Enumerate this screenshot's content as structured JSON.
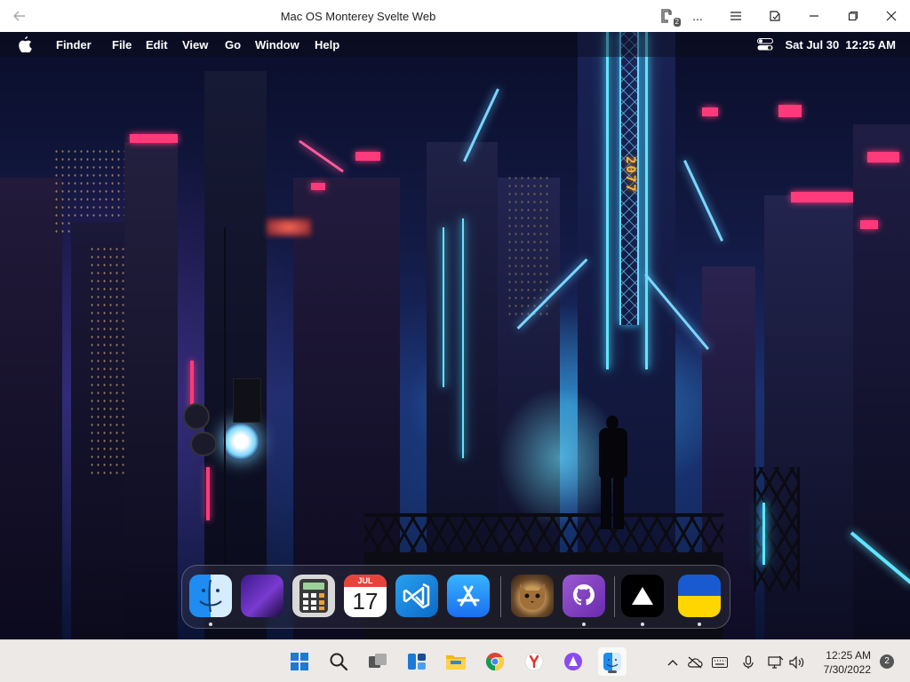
{
  "window": {
    "title": "Mac OS Monterey Svelte Web",
    "extension_badge": "2",
    "more_label": "..."
  },
  "menubar": {
    "app_name": "Finder",
    "items": [
      "File",
      "Edit",
      "View",
      "Go",
      "Window",
      "Help"
    ],
    "datetime": "Sat Jul 30  12:25 AM"
  },
  "wallpaper": {
    "tower_text": "2077"
  },
  "dock": {
    "apps": [
      {
        "name": "Finder",
        "icon": "finder-icon",
        "running": true
      },
      {
        "name": "Wallpapers",
        "icon": "wallpaper-icon",
        "running": false
      },
      {
        "name": "Calculator",
        "icon": "calculator-icon",
        "running": false
      },
      {
        "name": "Calendar",
        "icon": "calendar-icon",
        "running": false,
        "month": "JUL",
        "day": "17"
      },
      {
        "name": "VS Code",
        "icon": "vscode-icon",
        "running": false
      },
      {
        "name": "App Store",
        "icon": "appstore-icon",
        "running": false
      },
      {
        "name": "Photo",
        "icon": "cat-photo-icon",
        "running": false
      },
      {
        "name": "GitHub",
        "icon": "github-icon",
        "running": true
      },
      {
        "name": "Vercel",
        "icon": "vercel-icon",
        "running": false
      },
      {
        "name": "Ukraine",
        "icon": "ukraine-flag-icon",
        "running": true
      }
    ]
  },
  "taskbar": {
    "time": "12:25 AM",
    "date": "7/30/2022",
    "notification_count": "2"
  },
  "colors": {
    "titlebar_bg": "#ffffff",
    "taskbar_bg": "#ece9e6",
    "neon_cyan": "#5ee6ff",
    "neon_pink": "#ff3a7a"
  }
}
